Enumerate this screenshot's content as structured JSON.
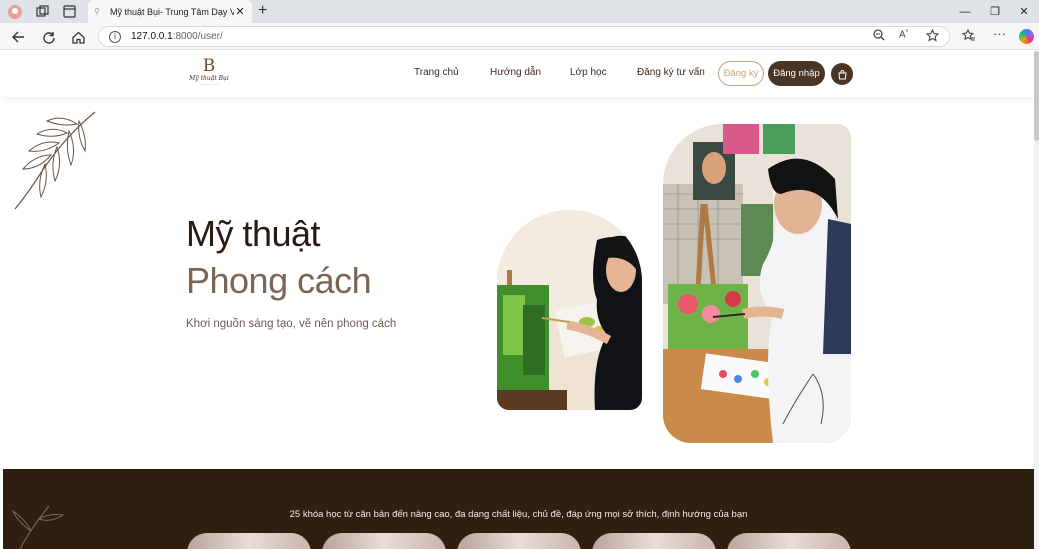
{
  "browser": {
    "tab_title": "Mỹ thuật Bụi- Trung Tâm Dạy Vẽ",
    "url_host": "127.0.0.1",
    "url_path": ":8000/user/",
    "icons": [
      "profile-icon",
      "workspaces-icon",
      "tab-actions-icon",
      "back-icon",
      "refresh-icon",
      "home-icon",
      "info-icon",
      "zoom-icon",
      "read-aloud-icon",
      "favorite-icon",
      "favorites-bar-icon",
      "more-icon",
      "copilot-icon"
    ]
  },
  "site": {
    "logo_letter": "B",
    "logo_name": "Mỹ thuật Bụi",
    "nav": [
      "Trang chủ",
      "Hướng dẫn",
      "Lớp học",
      "Đăng ký tư vấn"
    ],
    "register_label": "Đăng ký",
    "login_label": "Đăng nhập",
    "accent": "#4a3423",
    "accent_light": "#c9a27e"
  },
  "hero": {
    "title_line1": "Mỹ thuật",
    "title_line2": "Phong cách",
    "subtitle": "Khơi nguồn sáng tạo, vẽ nên phong cách"
  },
  "courses_band": {
    "text": "25 khóa học từ căn bản đến nâng cao, đa dạng chất liệu, chủ đề, đáp ứng mọi sở thích, định hướng của bạn",
    "background": "#2f1f10"
  }
}
